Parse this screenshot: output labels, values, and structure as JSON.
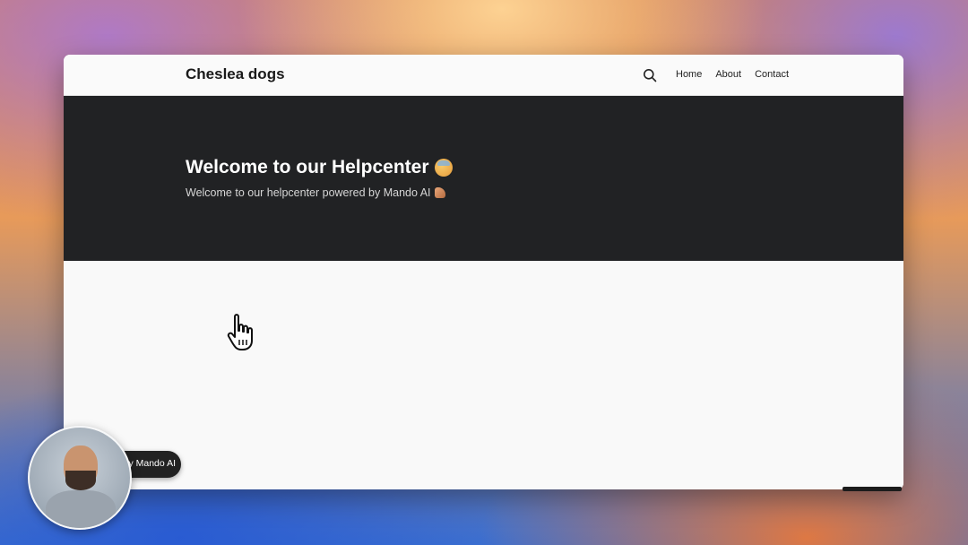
{
  "header": {
    "brand": "Cheslea dogs",
    "search_icon": "search-icon",
    "nav": [
      {
        "label": "Home"
      },
      {
        "label": "About"
      },
      {
        "label": "Contact"
      }
    ]
  },
  "hero": {
    "title": "Welcome to our Helpcenter",
    "title_emoji": "face-emoji-icon",
    "subtitle": "Welcome to our helpcenter powered by Mando AI",
    "subtitle_emoji": "flexed-biceps-icon",
    "background_color": "#212224"
  },
  "widget": {
    "label": "by Mando AI"
  }
}
